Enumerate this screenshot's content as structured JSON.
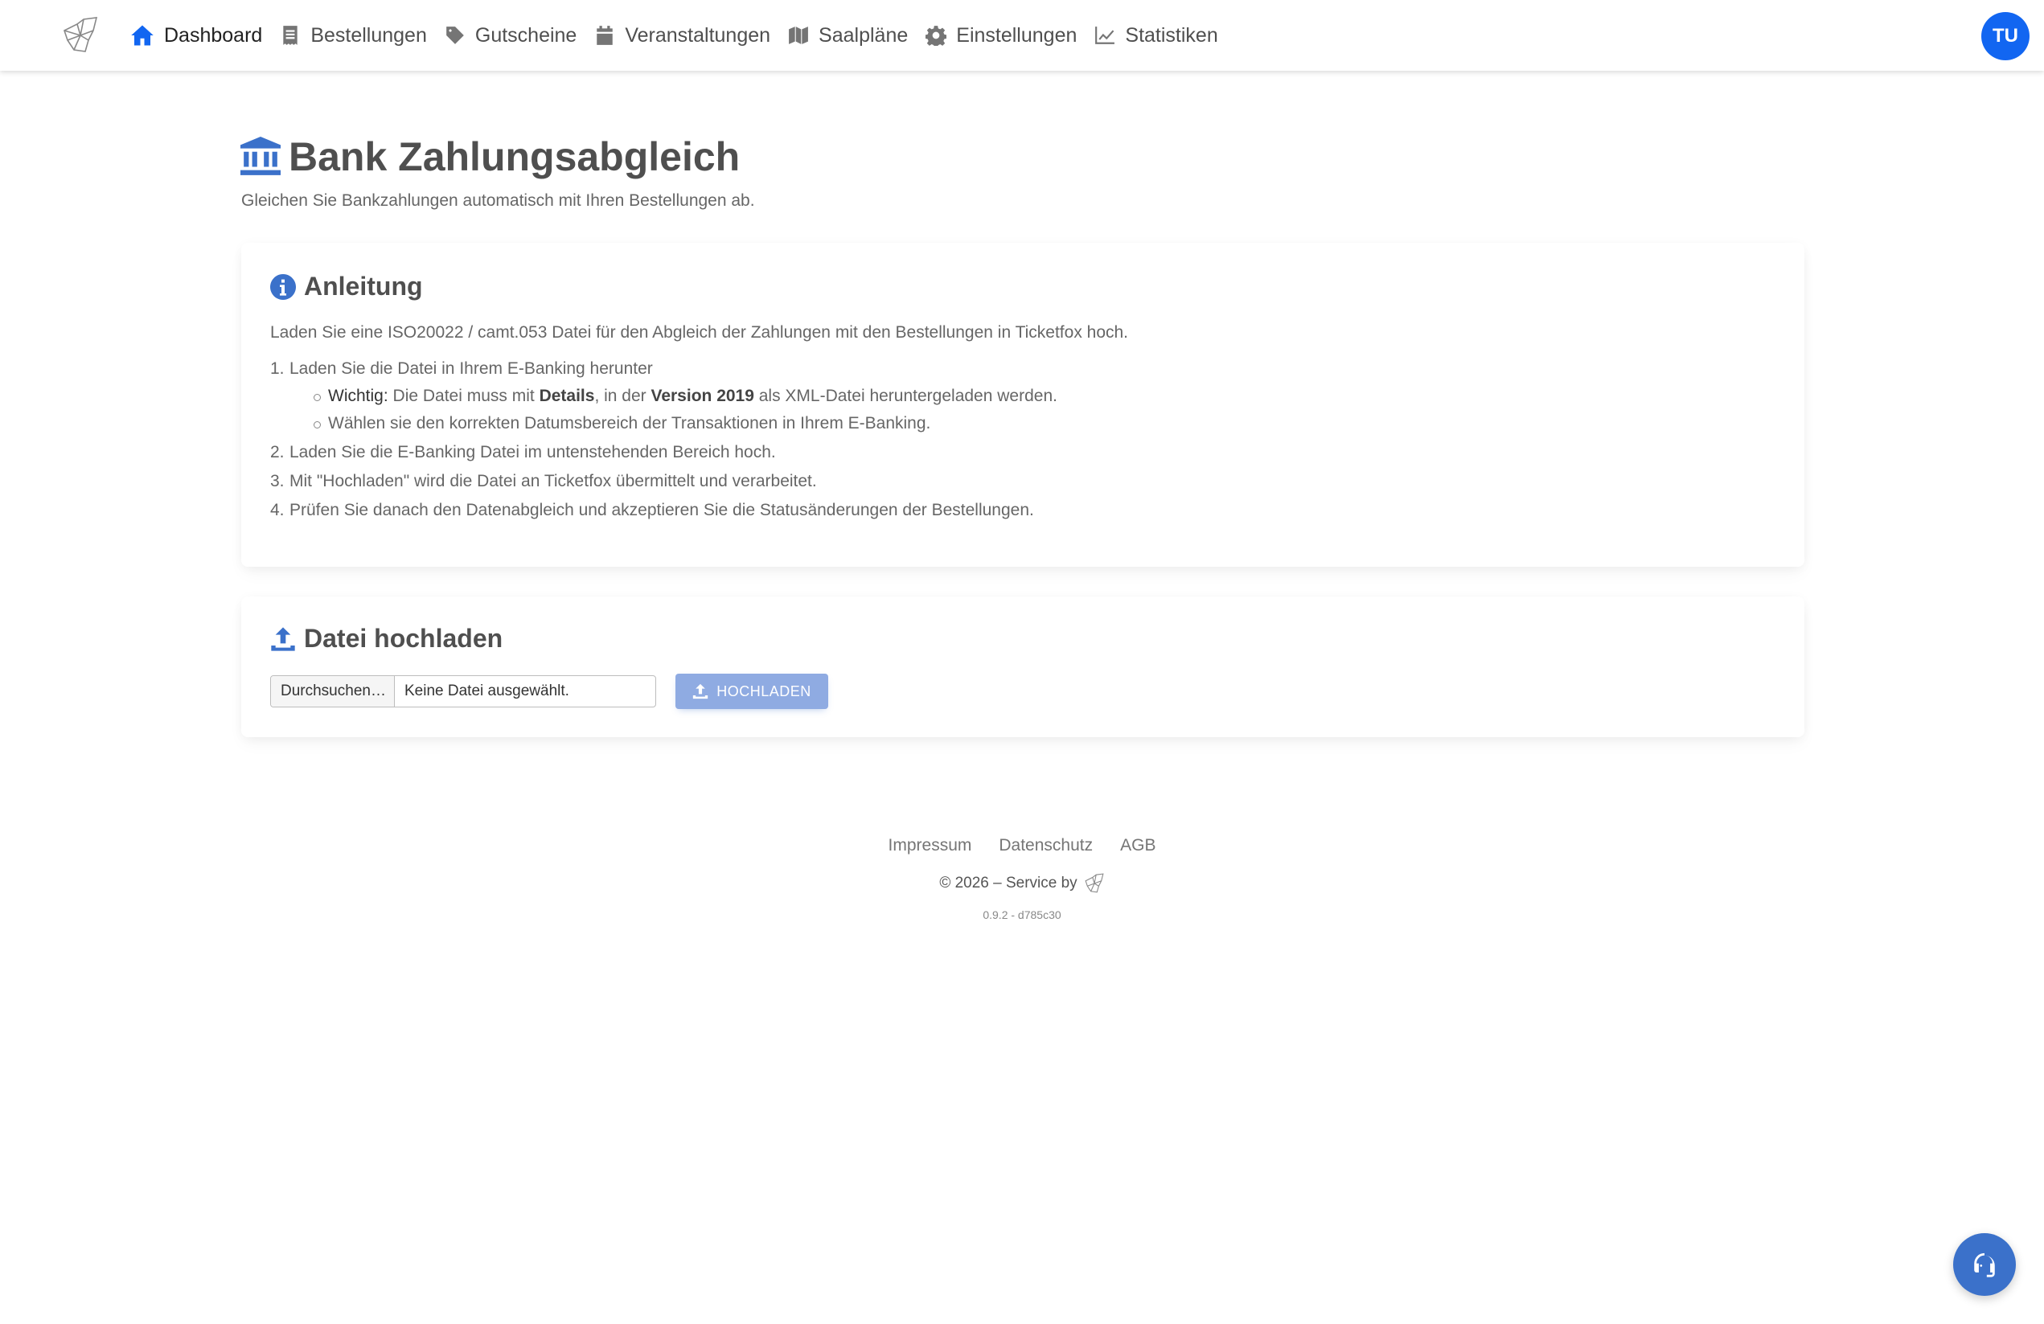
{
  "nav": {
    "items": [
      {
        "label": "Dashboard",
        "icon": "home-icon",
        "active": true
      },
      {
        "label": "Bestellungen",
        "icon": "receipt-icon",
        "active": false
      },
      {
        "label": "Gutscheine",
        "icon": "tag-icon",
        "active": false
      },
      {
        "label": "Veranstaltungen",
        "icon": "calendar-icon",
        "active": false
      },
      {
        "label": "Saalpläne",
        "icon": "map-icon",
        "active": false
      },
      {
        "label": "Einstellungen",
        "icon": "gear-icon",
        "active": false
      },
      {
        "label": "Statistiken",
        "icon": "chart-line-icon",
        "active": false
      }
    ],
    "avatar_initials": "TU"
  },
  "header": {
    "title": "Bank Zahlungsabgleich",
    "subtitle": "Gleichen Sie Bankzahlungen automatisch mit Ihren Bestellungen ab."
  },
  "instructions": {
    "title": "Anleitung",
    "intro": "Laden Sie eine ISO20022 / camt.053 Datei für den Abgleich der Zahlungen mit den Bestellungen in Ticketfox hoch.",
    "step1": "Laden Sie die Datei in Ihrem E-Banking herunter",
    "sub1": {
      "label": "Wichtig:",
      "t1": " Die Datei muss mit ",
      "b1": "Details",
      "t2": ", in der ",
      "b2": "Version 2019",
      "t3": " als XML-Datei heruntergeladen werden."
    },
    "sub2": "Wählen sie den korrekten Datumsbereich der Transaktionen in Ihrem E-Banking.",
    "step2": "Laden Sie die E-Banking Datei im untenstehenden Bereich hoch.",
    "step3": "Mit \"Hochladen\" wird die Datei an Ticketfox übermittelt und verarbeitet.",
    "step4": "Prüfen Sie danach den Datenabgleich und akzeptieren Sie die Statusänderungen der Bestellungen."
  },
  "upload": {
    "title": "Datei hochladen",
    "browse_label": "Durchsuchen…",
    "file_status": "Keine Datei ausgewählt.",
    "button_label": "HOCHLADEN"
  },
  "footer": {
    "links": [
      "Impressum",
      "Datenschutz",
      "AGB"
    ],
    "copyright": "© 2026 – Service by",
    "version": "0.9.2 - d785c30"
  },
  "colors": {
    "primary": "#1266f1",
    "accent": "#3b71ca",
    "button_disabled": "#8fabe2"
  }
}
